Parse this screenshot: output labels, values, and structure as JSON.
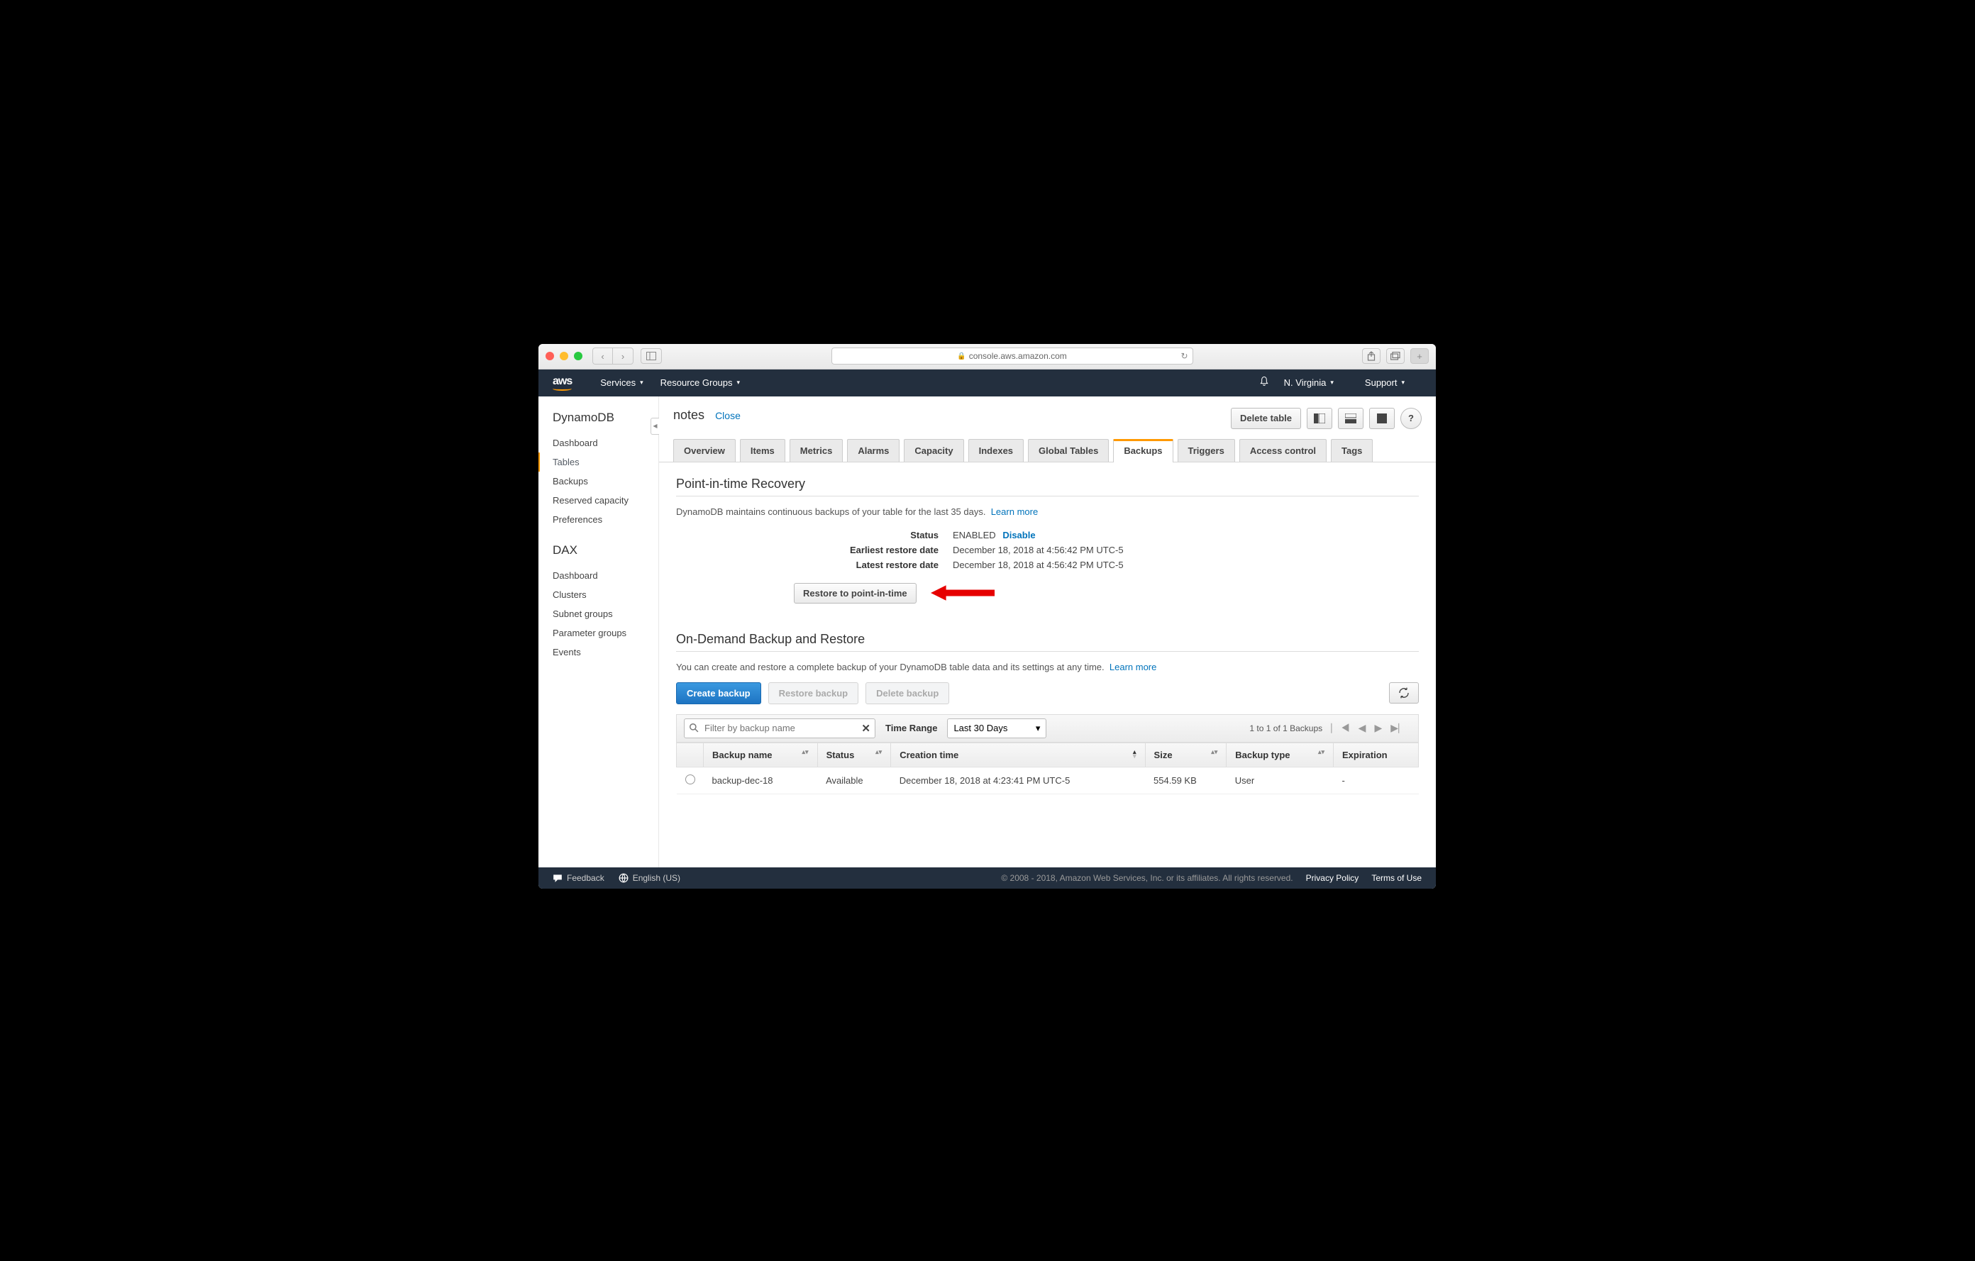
{
  "browser": {
    "url": "console.aws.amazon.com"
  },
  "aws_header": {
    "services": "Services",
    "resource_groups": "Resource Groups",
    "region": "N. Virginia",
    "support": "Support"
  },
  "sidebar": {
    "title1": "DynamoDB",
    "items1": [
      "Dashboard",
      "Tables",
      "Backups",
      "Reserved capacity",
      "Preferences"
    ],
    "title2": "DAX",
    "items2": [
      "Dashboard",
      "Clusters",
      "Subnet groups",
      "Parameter groups",
      "Events"
    ]
  },
  "main": {
    "breadcrumb": "notes",
    "close": "Close",
    "delete_table": "Delete table",
    "tabs": [
      "Overview",
      "Items",
      "Metrics",
      "Alarms",
      "Capacity",
      "Indexes",
      "Global Tables",
      "Backups",
      "Triggers",
      "Access control",
      "Tags"
    ],
    "active_tab": "Backups",
    "pitr": {
      "heading": "Point-in-time Recovery",
      "desc": "DynamoDB maintains continuous backups of your table for the last 35 days.",
      "learn_more": "Learn more",
      "status_label": "Status",
      "status_value": "ENABLED",
      "disable": "Disable",
      "earliest_label": "Earliest restore date",
      "earliest_value": "December 18, 2018 at 4:56:42 PM UTC-5",
      "latest_label": "Latest restore date",
      "latest_value": "December 18, 2018 at 4:56:42 PM UTC-5",
      "restore_btn": "Restore to point-in-time"
    },
    "ondemand": {
      "heading": "On-Demand Backup and Restore",
      "desc": "You can create and restore a complete backup of your DynamoDB table data and its settings at any time.",
      "learn_more": "Learn more",
      "create": "Create backup",
      "restore": "Restore backup",
      "delete": "Delete backup",
      "filter_placeholder": "Filter by backup name",
      "time_range_label": "Time Range",
      "time_range_value": "Last 30 Days",
      "pager_info": "1 to 1 of 1 Backups",
      "columns": [
        "Backup name",
        "Status",
        "Creation time",
        "Size",
        "Backup type",
        "Expiration"
      ],
      "rows": [
        {
          "name": "backup-dec-18",
          "status": "Available",
          "creation": "December 18, 2018 at 4:23:41 PM UTC-5",
          "size": "554.59 KB",
          "type": "User",
          "expiration": "-"
        }
      ]
    }
  },
  "footer": {
    "feedback": "Feedback",
    "language": "English (US)",
    "copyright": "© 2008 - 2018, Amazon Web Services, Inc. or its affiliates. All rights reserved.",
    "privacy": "Privacy Policy",
    "terms": "Terms of Use"
  }
}
